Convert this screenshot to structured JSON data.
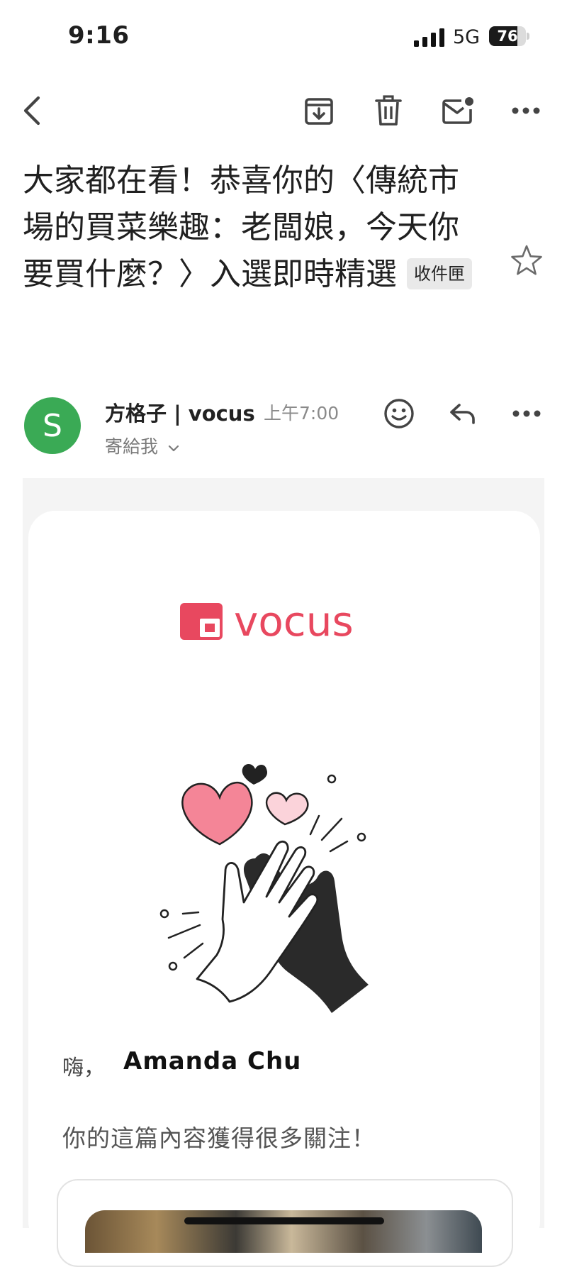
{
  "status_bar": {
    "time": "9:16",
    "network": "5G",
    "battery_level": "76",
    "battery_fraction": 0.76
  },
  "toolbar": {
    "icons": [
      "back-arrow-icon",
      "archive-icon",
      "trash-icon",
      "mark-unread-icon",
      "more-icon"
    ]
  },
  "subject": {
    "text": "大家都在看！恭喜你的〈傳統市場的買菜樂趣：老闆娘，今天你要買什麼？〉入選即時精選",
    "label": "收件匣",
    "starred": false
  },
  "sender": {
    "avatar_letter": "S",
    "avatar_color": "#3aaa55",
    "name": "方格子 | vocus",
    "time": "上午7:00",
    "recipient": "寄給我"
  },
  "email": {
    "brand": "vocus",
    "brand_color": "#e8485f",
    "greeting": "嗨，",
    "recipient_name": "Amanda Chu",
    "message": "你的這篇內容獲得很多關注！"
  }
}
